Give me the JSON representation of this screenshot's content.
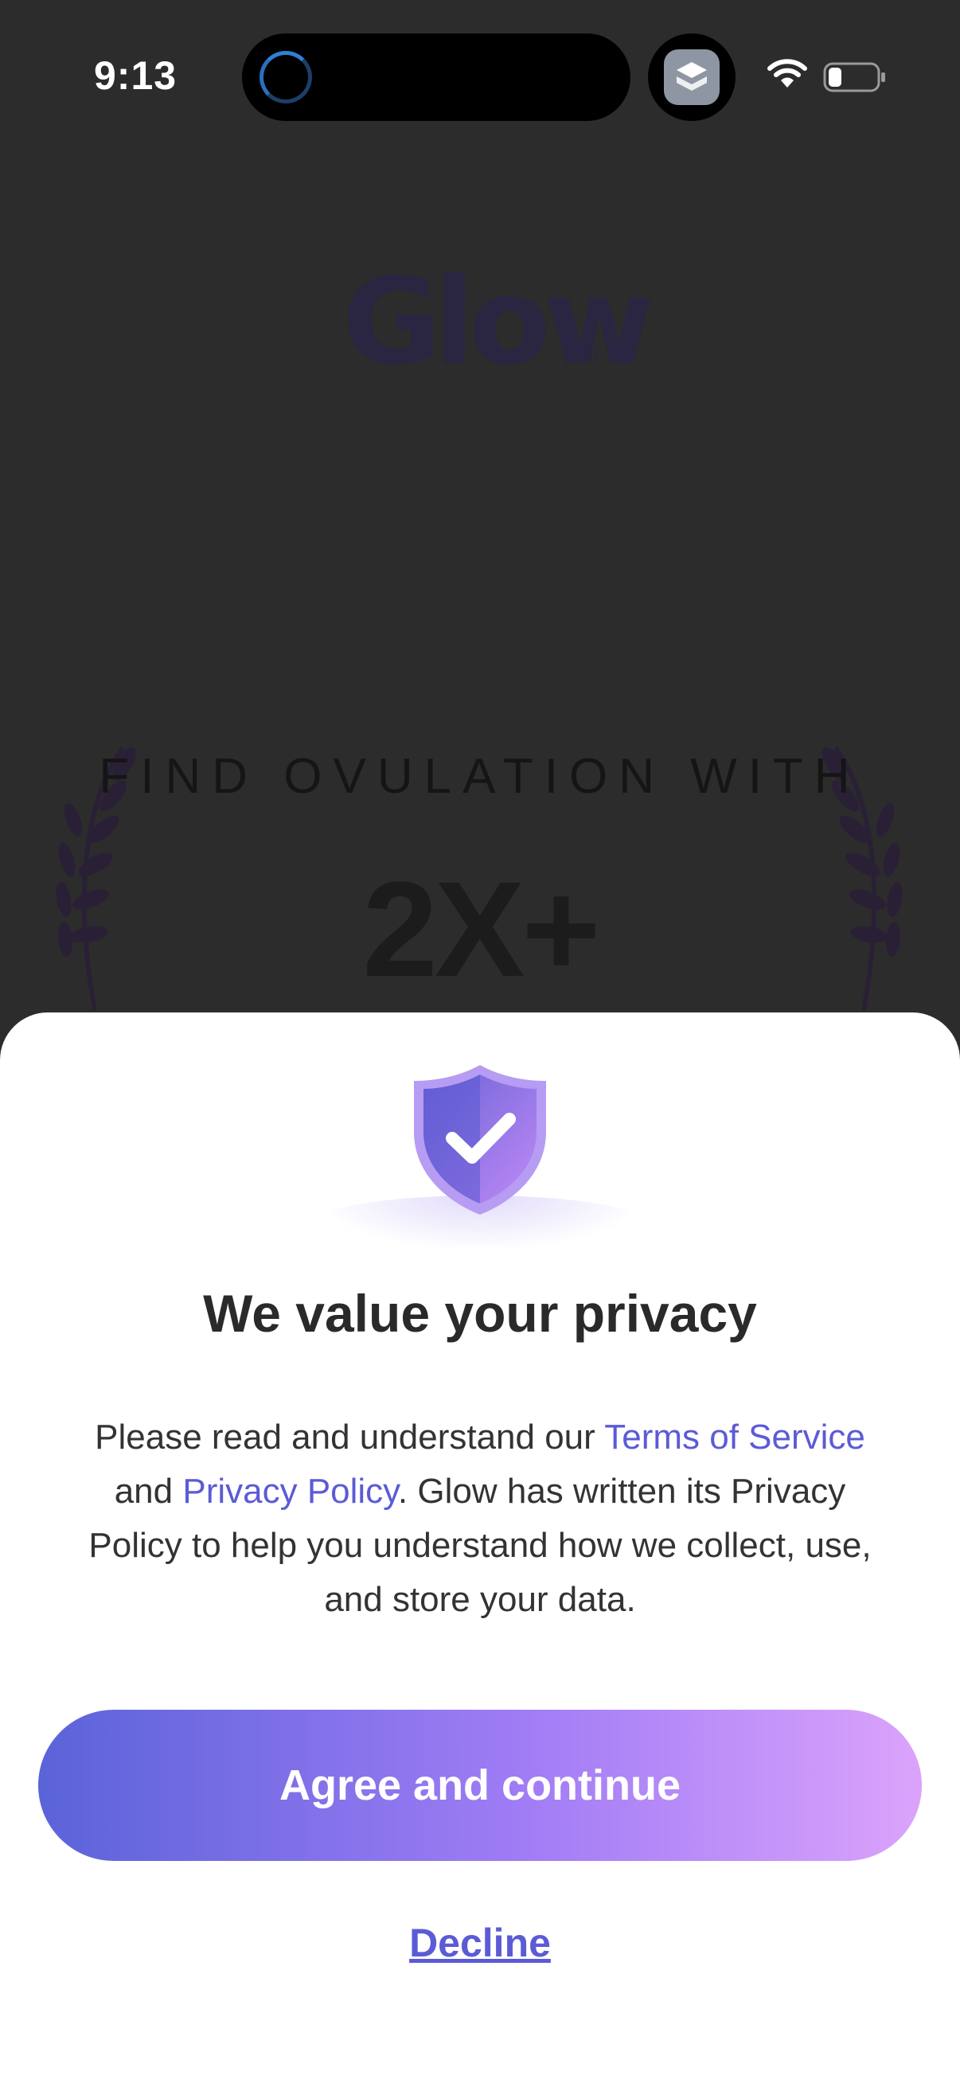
{
  "status_bar": {
    "time": "9:13"
  },
  "background": {
    "logo_text": "Glow",
    "logo_reg_mark": "®",
    "tagline": "FIND OVULATION WITH",
    "stat": "2X+"
  },
  "sheet": {
    "title": "We value your privacy",
    "body_part1": "Please read and understand our ",
    "terms_link": "Terms of Service",
    "body_part2": " and ",
    "privacy_link": "Privacy Policy",
    "body_part3": ". Glow has written its Privacy Policy to help you understand how we collect, use, and store your data.",
    "agree_label": "Agree and continue",
    "decline_label": "Decline"
  },
  "colors": {
    "accent": "#5b5bd6",
    "gradient_start": "#5b63d9",
    "gradient_end": "#dba3fb"
  },
  "icons": [
    "spinner-icon",
    "app-switcher-icon",
    "wifi-icon",
    "battery-icon",
    "shield-check-icon",
    "laurel-icon"
  ]
}
